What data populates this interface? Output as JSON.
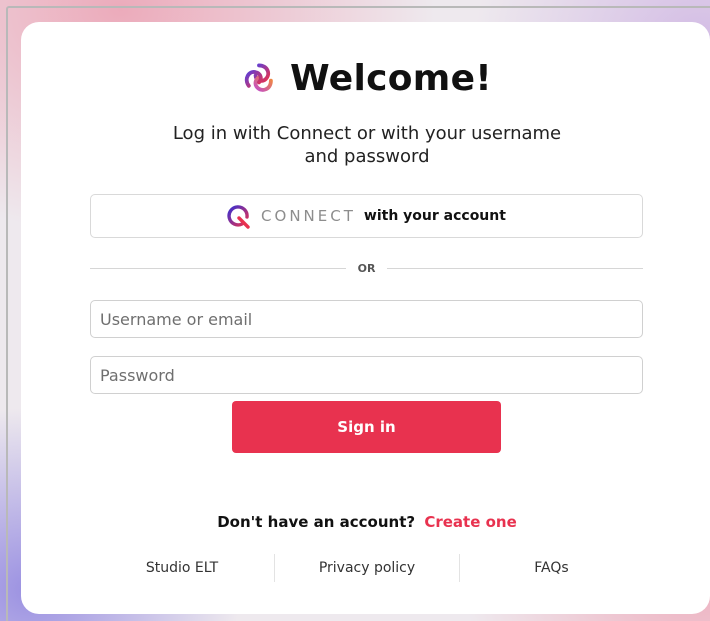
{
  "title": "Welcome!",
  "subtitle": "Log in with Connect or with your username and password",
  "connect_button": {
    "brand_word": "CONNECT",
    "suffix": "with your account",
    "logo_icon": "connect-q-logo-icon",
    "brand_color": "#e8324f"
  },
  "divider_label": "OR",
  "username_placeholder": "Username or email",
  "password_placeholder": "Password",
  "signin_label": "Sign in",
  "signup": {
    "prompt": "Don't have an account?",
    "link": "Create one"
  },
  "footer": {
    "links": [
      "Studio ELT",
      "Privacy policy",
      "FAQs"
    ]
  },
  "colors": {
    "accent": "#e8324f",
    "text": "#111111"
  }
}
